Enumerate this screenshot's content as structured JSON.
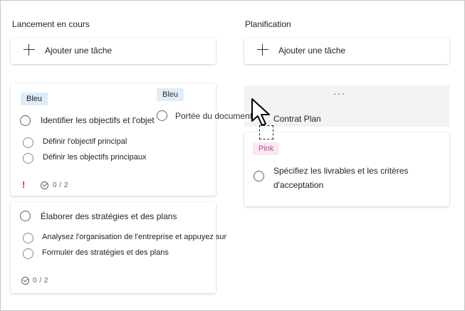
{
  "columns": [
    {
      "title": "Lancement en cours",
      "add_label": "Ajouter une tâche"
    },
    {
      "title": "Planification",
      "add_label": "Ajouter une tâche"
    }
  ],
  "card1": {
    "tag": "Bleu",
    "title": "Identifier les objectifs et l'objet",
    "subtasks": [
      "Définir l'objectif principal",
      "Définir les objectifs principaux"
    ],
    "progress": "0 / 2",
    "priority_icon": "!"
  },
  "card2": {
    "title": "Élaborer des stratégies et des plans",
    "subtasks": [
      "Analysez l'organisation de l'entreprise et appuyez sur",
      "Formuler des stratégies et des plans"
    ],
    "progress": "0 / 2"
  },
  "dragged_card": {
    "tag": "Bleu",
    "title": "Portée du document"
  },
  "planning_card": {
    "more": "···",
    "title": "Contrat Plan"
  },
  "card3": {
    "tag": "Pink",
    "title_line1": "Spécifiez les livrables et les critères",
    "title_line2": "d'acceptation"
  },
  "colors": {
    "blue_tag": "#deecf9",
    "pink_tag": "#fde7f3",
    "priority": "#c4314b"
  }
}
